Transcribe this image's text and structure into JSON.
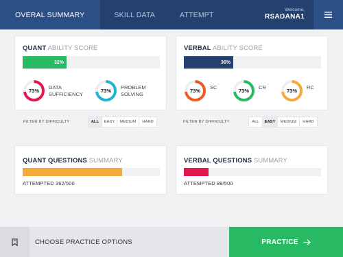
{
  "nav": {
    "tabs": [
      {
        "label": "OVERAL SUMMARY",
        "active": true
      },
      {
        "label": "SKILL DATA",
        "active": false
      },
      {
        "label": "ATTEMPT",
        "active": false
      }
    ],
    "welcome_text": "Welcome,",
    "username": "RSADANA1",
    "menu_icon": "hamburger-menu-icon"
  },
  "quant_ability": {
    "title_bold": "QUANT",
    "title_rest": " ABILITY SCORE",
    "score_text": "32%",
    "score_value": 0.32,
    "bar_color": "#27ba63",
    "donuts": [
      {
        "value_text": "73%",
        "value": 0.73,
        "color": "#e0194f",
        "label_line1": "DATA",
        "label_line2": "SUFFICIENCY"
      },
      {
        "value_text": "73%",
        "value": 0.73,
        "color": "#1fb3d6",
        "label_line1": "PROBLEM",
        "label_line2": "SOLVING"
      }
    ]
  },
  "verbal_ability": {
    "title_bold": "VERBAL",
    "title_rest": " ABILITY SCORE",
    "score_text": "36%",
    "score_value": 0.36,
    "bar_color": "#23406f",
    "donuts": [
      {
        "value_text": "73%",
        "value": 0.73,
        "color": "#f05a1e",
        "label": "SC"
      },
      {
        "value_text": "73%",
        "value": 0.73,
        "color": "#27ba63",
        "label": "CR"
      },
      {
        "value_text": "73%",
        "value": 0.73,
        "color": "#f4a93a",
        "label": "RC"
      }
    ]
  },
  "quant_filter": {
    "label": "FILTER BY DIFFICULTY",
    "options": [
      "ALL",
      "EASY",
      "MEDIUM",
      "HARD"
    ],
    "selected": "ALL"
  },
  "verbal_filter": {
    "label": "FILTER BY DIFFICULTY",
    "options": [
      "ALL",
      "EASY",
      "MEDIUM",
      "HARD"
    ],
    "selected": "EASY"
  },
  "quant_questions": {
    "title_bold": "QUANT QUESTIONS",
    "title_rest": " SUMMARY",
    "attempted_text": "ATTEMPTED 362/500",
    "progress": 0.724,
    "bar_color": "#f4a93a"
  },
  "verbal_questions": {
    "title_bold": "VERBAL QUESTIONS",
    "title_rest": " SUMMARY",
    "attempted_text": "ATTEMPTED 89/500",
    "progress": 0.178,
    "bar_color": "#e0194f"
  },
  "bottom": {
    "icon": "bookmark-icon",
    "choose_text": "CHOOSE PRACTICE OPTIONS",
    "practice_label": "PRACTICE",
    "practice_icon": "arrow-right-icon"
  }
}
